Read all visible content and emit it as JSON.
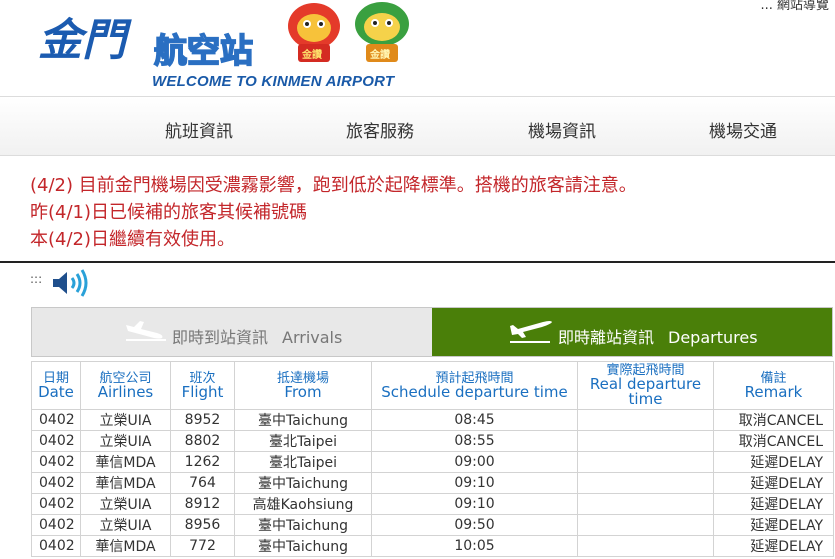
{
  "header": {
    "sitemap_link": "... 網站導覽",
    "logo_title_kinmen": "金門",
    "logo_title_airport": "航空站",
    "logo_subtitle": "WELCOME TO KINMEN AIRPORT",
    "mascot_badge_left": "金讚",
    "mascot_badge_right": "金讚"
  },
  "nav": {
    "items": [
      {
        "label": "航班資訊"
      },
      {
        "label": "旅客服務"
      },
      {
        "label": "機場資訊"
      },
      {
        "label": "機場交通"
      }
    ]
  },
  "notice": {
    "lines": [
      "(4/2) 目前金門機場因受濃霧影響，跑到低於起降標準。搭機的旅客請注意。",
      "昨(4/1)日已候補的旅客其候補號碼",
      "本(4/2)日繼續有效使用。"
    ]
  },
  "audio": {
    "dots": ":::",
    "icon": "speaker-icon"
  },
  "tabs": {
    "arrivals": {
      "zh": "即時到站資訊",
      "en": "Arrivals",
      "icon": "plane-landing-icon"
    },
    "departures": {
      "zh": "即時離站資訊",
      "en": "Departures",
      "icon": "plane-takeoff-icon"
    },
    "active": "departures",
    "active_color": "#4a7f09"
  },
  "table": {
    "columns": [
      {
        "zh": "日期",
        "en": "Date"
      },
      {
        "zh": "航空公司",
        "en": "Airlines"
      },
      {
        "zh": "班次",
        "en": "Flight"
      },
      {
        "zh": "抵達機場",
        "en": "From"
      },
      {
        "zh": "預計起飛時間",
        "en": "Schedule departure time"
      },
      {
        "zh": "實際起飛時間",
        "en": "Real departure time"
      },
      {
        "zh": "備註",
        "en": "Remark"
      }
    ],
    "rows": [
      {
        "date": "0402",
        "airline": "立榮UIA",
        "flight": "8952",
        "to": "臺中Taichung",
        "scheduled": "08:45",
        "actual": "",
        "remark": "取消CANCEL"
      },
      {
        "date": "0402",
        "airline": "立榮UIA",
        "flight": "8802",
        "to": "臺北Taipei",
        "scheduled": "08:55",
        "actual": "",
        "remark": "取消CANCEL"
      },
      {
        "date": "0402",
        "airline": "華信MDA",
        "flight": "1262",
        "to": "臺北Taipei",
        "scheduled": "09:00",
        "actual": "",
        "remark": "延遲DELAY"
      },
      {
        "date": "0402",
        "airline": "華信MDA",
        "flight": "764",
        "to": "臺中Taichung",
        "scheduled": "09:10",
        "actual": "",
        "remark": "延遲DELAY"
      },
      {
        "date": "0402",
        "airline": "立榮UIA",
        "flight": "8912",
        "to": "高雄Kaohsiung",
        "scheduled": "09:10",
        "actual": "",
        "remark": "延遲DELAY"
      },
      {
        "date": "0402",
        "airline": "立榮UIA",
        "flight": "8956",
        "to": "臺中Taichung",
        "scheduled": "09:50",
        "actual": "",
        "remark": "延遲DELAY"
      },
      {
        "date": "0402",
        "airline": "華信MDA",
        "flight": "772",
        "to": "臺中Taichung",
        "scheduled": "10:05",
        "actual": "",
        "remark": "延遲DELAY"
      }
    ]
  }
}
